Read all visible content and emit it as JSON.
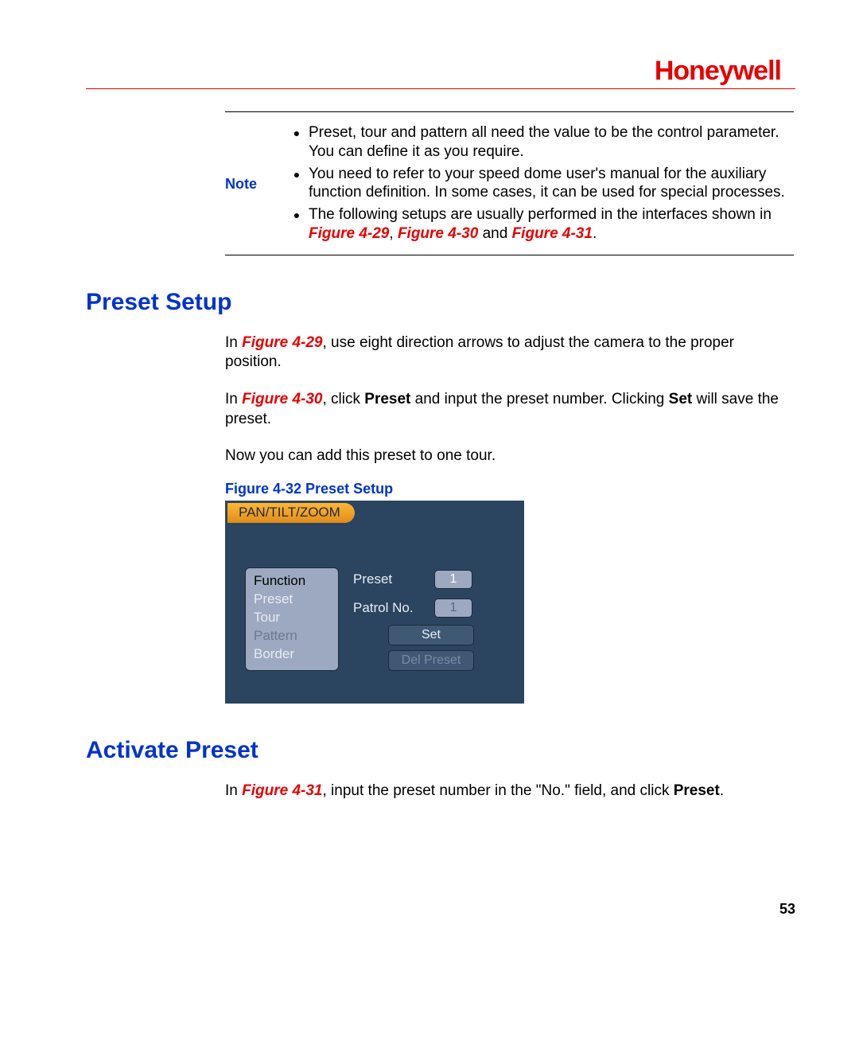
{
  "brand": "Honeywell",
  "note": {
    "label": "Note",
    "items": [
      {
        "text": "Preset, tour and pattern all need the value to be the control parameter. You can define it as you require."
      },
      {
        "text": "You need to refer to your speed dome user's manual for the auxiliary function definition. In some cases, it can be used for special processes."
      },
      {
        "prefix": "The following setups are usually performed in the interfaces shown in ",
        "ref1": "Figure 4-29",
        "sep1": ", ",
        "ref2": "Figure 4-30",
        "sep2": " and ",
        "ref3": "Figure 4-31",
        "suffix": "."
      }
    ]
  },
  "sections": {
    "preset_setup": {
      "heading": "Preset Setup",
      "p1": {
        "pre": "In ",
        "ref": "Figure 4-29",
        "post": ", use eight direction arrows to adjust the camera to the proper position."
      },
      "p2": {
        "pre": "In ",
        "ref": "Figure 4-30",
        "mid1": ", click ",
        "b1": "Preset",
        "mid2": " and input the preset number. Clicking ",
        "b2": "Set",
        "post": " will save the preset."
      },
      "p3": "Now you can add this preset to one tour.",
      "figure_caption": "Figure 4-32 Preset Setup"
    },
    "activate_preset": {
      "heading": "Activate Preset",
      "p1": {
        "pre": "In ",
        "ref": "Figure 4-31",
        "mid": ", input the preset number in the \"No.\" field, and click ",
        "b": "Preset",
        "post": "."
      }
    }
  },
  "ptz_panel": {
    "tab": "PAN/TILT/ZOOM",
    "function_box": {
      "title": "Function",
      "items": [
        "Preset",
        "Tour",
        "Pattern",
        "Border"
      ],
      "dim_index": 2
    },
    "controls": {
      "preset_label": "Preset",
      "preset_value": "1",
      "patrol_label": "Patrol No.",
      "patrol_value": "1",
      "set_btn": "Set",
      "del_btn": "Del Preset"
    }
  },
  "page_number": "53"
}
